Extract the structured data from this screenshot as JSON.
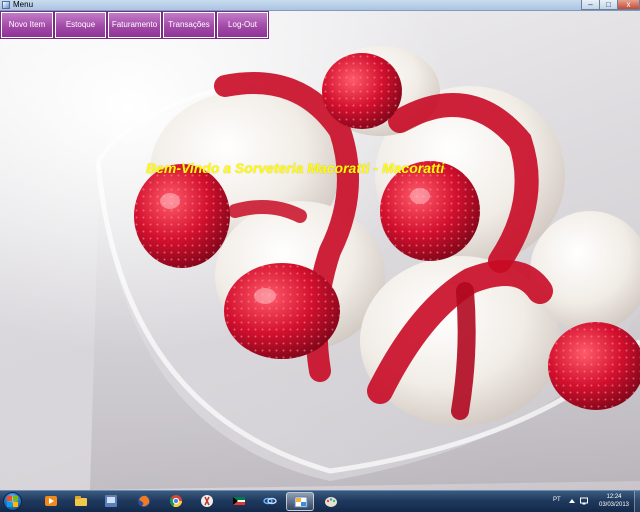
{
  "window": {
    "title": "Menu",
    "minimize_glyph": "–",
    "maximize_glyph": "□",
    "close_glyph": "x"
  },
  "menu": {
    "items": [
      {
        "label": "Novo Item"
      },
      {
        "label": "Estoque"
      },
      {
        "label": "Faturamento"
      },
      {
        "label": "Transações"
      },
      {
        "label": "Log-Out"
      }
    ]
  },
  "welcome": {
    "text": "Bem-Vindo a Sorveteria Macoratti - Macoratti"
  },
  "taskbar": {
    "start_icon": "windows-logo-icon",
    "pinned": [
      {
        "icon": "media-player-icon"
      },
      {
        "icon": "file-explorer-icon"
      },
      {
        "icon": "visual-studio-icon"
      },
      {
        "icon": "firefox-icon"
      },
      {
        "icon": "chrome-icon"
      },
      {
        "icon": "snipping-tool-icon"
      },
      {
        "icon": "flag-app-icon"
      },
      {
        "icon": "network-app-icon"
      },
      {
        "icon": "menu-app-icon",
        "active": true
      },
      {
        "icon": "paint-icon"
      }
    ],
    "tray": {
      "language": "PT",
      "time": "12:24",
      "date": "03/03/2013"
    }
  },
  "colors": {
    "menu_button": "#a34aa9",
    "welcome_text": "#ffff00",
    "taskbar": "#1f3a5e"
  }
}
